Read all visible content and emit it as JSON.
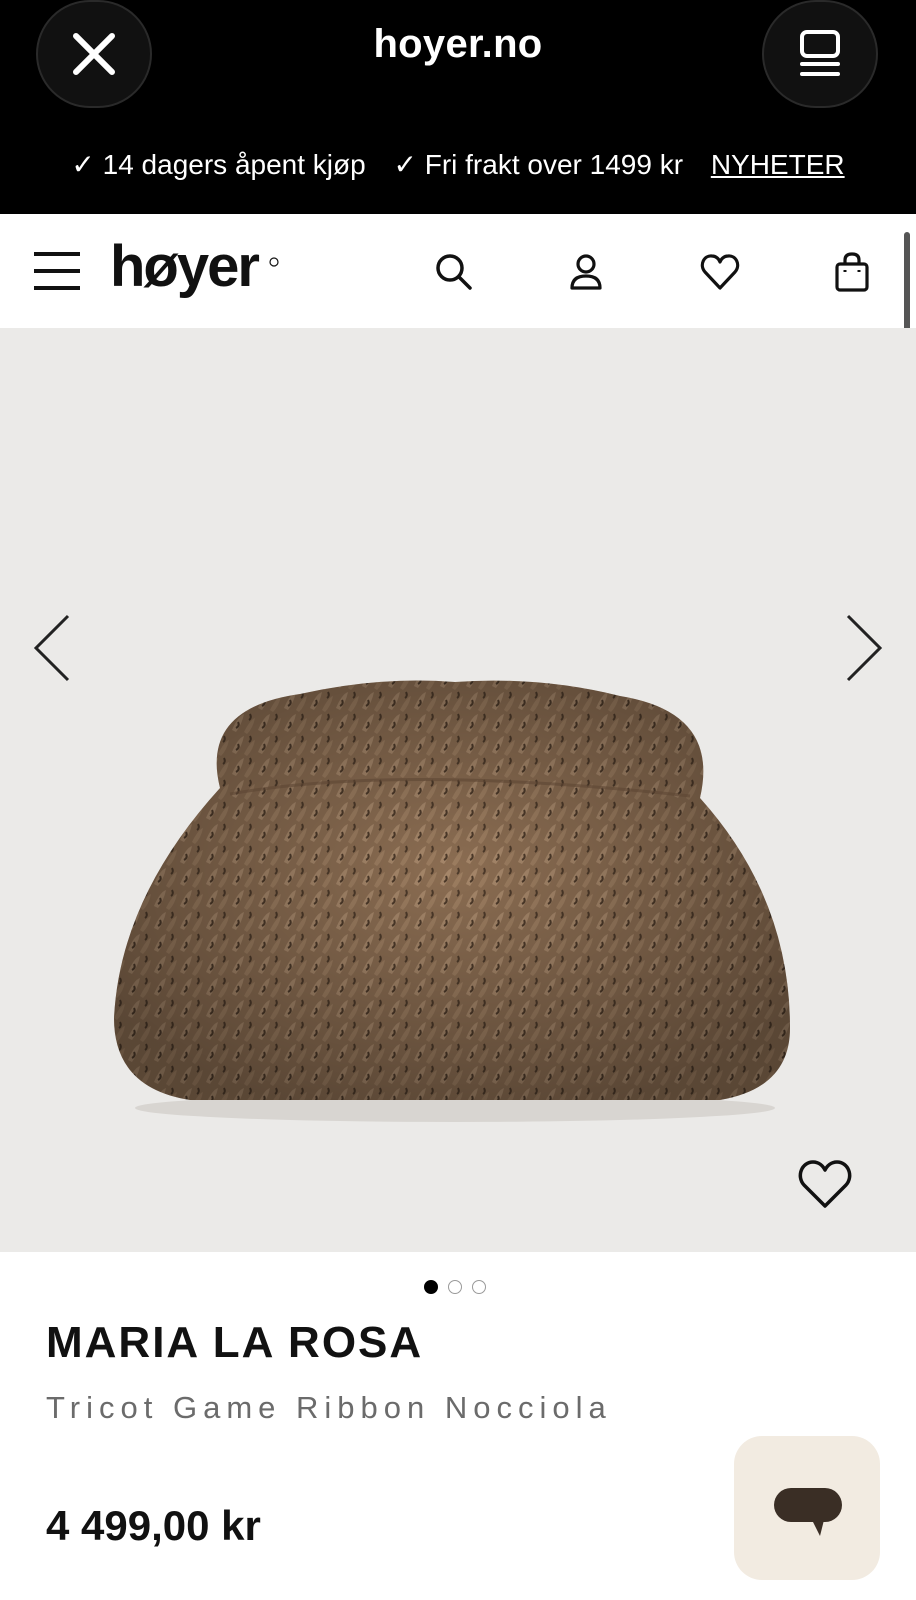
{
  "browser": {
    "url_title": "hoyer.no",
    "promos": [
      "✓ 14 dagers åpent kjøp",
      "✓ Fri frakt over 1499 kr"
    ],
    "promo_link": "NYHETER"
  },
  "header": {
    "logo_text": "høyer",
    "icons": [
      "menu-icon",
      "search-icon",
      "account-icon",
      "wishlist-icon",
      "cart-icon"
    ]
  },
  "product": {
    "brand": "MARIA LA ROSA",
    "name": "Tricot Game Ribbon Nocciola",
    "price": "4 499,00 kr",
    "image_count": 3,
    "active_image": 1,
    "bag_color": "#8b6d52"
  },
  "colors": {
    "top_bar": "#000000",
    "image_bg": "#ebeae8",
    "chat_bg": "#f2ebe1",
    "chat_icon": "#3a2e25"
  }
}
